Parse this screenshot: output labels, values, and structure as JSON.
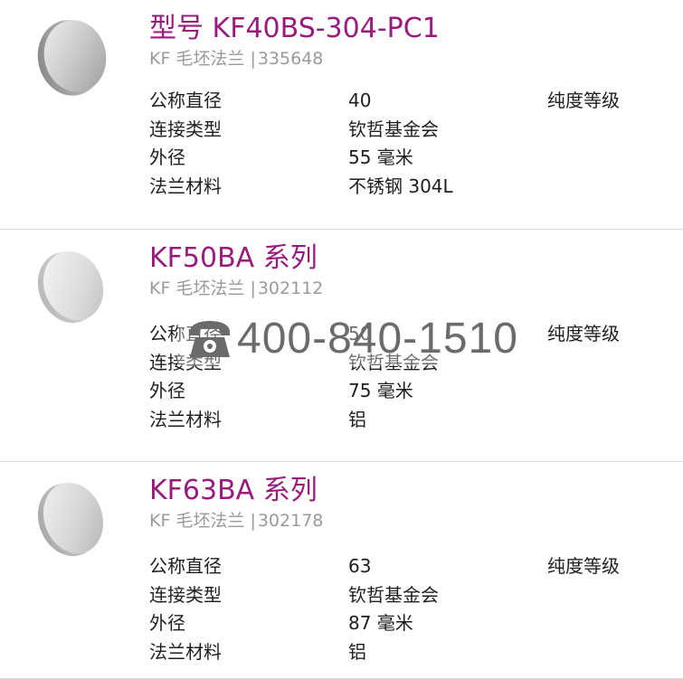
{
  "products": [
    {
      "title": "型号 KF40BS-304-PC1",
      "category": "KF 毛坯法兰",
      "separator": "|",
      "code": "335648",
      "specs": [
        {
          "label": "公称直径",
          "value": "40"
        },
        {
          "label": "连接类型",
          "value": "钦哲基金会"
        },
        {
          "label": "外径",
          "value": "55 毫米"
        },
        {
          "label": "法兰材料",
          "value": "不锈钢 304L"
        }
      ],
      "purity_label": "纯度等级"
    },
    {
      "title": "KF50BA 系列",
      "category": "KF 毛坯法兰",
      "separator": "|",
      "code": "302112",
      "specs": [
        {
          "label": "公称直径",
          "value": "50"
        },
        {
          "label": "连接类型",
          "value": "钦哲基金会"
        },
        {
          "label": "外径",
          "value": "75 毫米"
        },
        {
          "label": "法兰材料",
          "value": "铝"
        }
      ],
      "purity_label": "纯度等级"
    },
    {
      "title": "KF63BA 系列",
      "category": "KF 毛坯法兰",
      "separator": "|",
      "code": "302178",
      "specs": [
        {
          "label": "公称直径",
          "value": "63"
        },
        {
          "label": "连接类型",
          "value": "钦哲基金会"
        },
        {
          "label": "外径",
          "value": "87 毫米"
        },
        {
          "label": "法兰材料",
          "value": "铝"
        }
      ],
      "purity_label": "纯度等级"
    }
  ],
  "phone_overlay": {
    "number": "400-840-1510",
    "icon": "telephone-icon"
  },
  "colors": {
    "title": "#9a1b7e",
    "subtitle": "#9a9a9a",
    "text": "#1e1e1e",
    "divider": "#d9d9d9",
    "phone": "#6b6b6b"
  }
}
